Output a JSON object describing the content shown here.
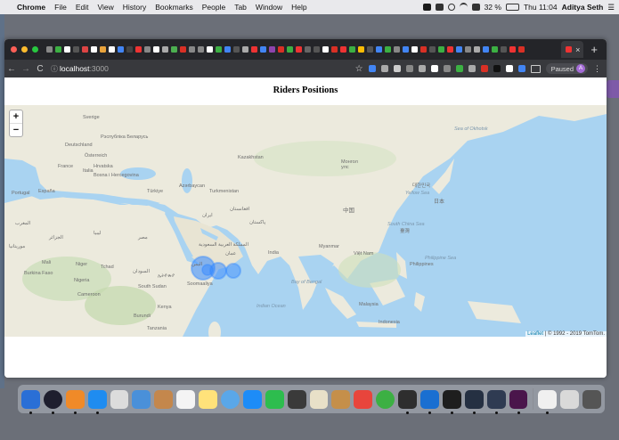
{
  "menubar": {
    "app": "Chrome",
    "items": [
      "File",
      "Edit",
      "View",
      "History",
      "Bookmarks",
      "People",
      "Tab",
      "Window",
      "Help"
    ],
    "battery": "32 %",
    "clock": "Thu 11:04",
    "user": "Aditya Seth"
  },
  "tabs": {
    "favicon_colors": [
      "#888",
      "#3cb043",
      "#fff",
      "#555",
      "#d44",
      "#fff",
      "#e8a33c",
      "#fff",
      "#4285f4",
      "#444",
      "#e33",
      "#888",
      "#fff",
      "#aaa",
      "#4caf50",
      "#d93025",
      "#888",
      "#888",
      "#fff",
      "#3cb043",
      "#4285f4",
      "#555",
      "#aaa",
      "#e33",
      "#4285f4",
      "#8e44ad",
      "#d93025",
      "#3cb043",
      "#e33",
      "#666",
      "#555",
      "#fff",
      "#d93025",
      "#e33",
      "#3cb043",
      "#fbbc05",
      "#555",
      "#4285f4",
      "#3cb043",
      "#888",
      "#4285f4",
      "#fff",
      "#d93025",
      "#555",
      "#3cb043",
      "#e33",
      "#4285f4",
      "#888",
      "#aaa",
      "#4285f4",
      "#3cb043",
      "#555",
      "#e33",
      "#d93025"
    ],
    "active_close": "×",
    "new_tab": "+"
  },
  "toolbar": {
    "back": "←",
    "forward": "→",
    "reload": "C",
    "url_host": "localhost",
    "url_port": ":3000",
    "star": "☆",
    "paused_label": "Paused",
    "avatar_letter": "A",
    "menu": "⋮",
    "extension_colors": [
      "#4285f4",
      "#aaa",
      "#ccc",
      "#888",
      "#aaa",
      "#fff",
      "#888",
      "#3cb043",
      "#aaa",
      "#d93025",
      "#111",
      "#fff",
      "#4285f4"
    ]
  },
  "page": {
    "title": "Riders Positions"
  },
  "map": {
    "zoom_in": "+",
    "zoom_out": "−",
    "attribution_link": "Leaflet",
    "attribution_text": " | © 1992 - 2019 TomTom.",
    "rider_marker_color": "#3388ff",
    "labels": {
      "kazakhstan": "Kazakhstan",
      "mongolia": "Монгол\nулс",
      "turkiye": "Türkiye",
      "turkmenistan": "Turkmenistan",
      "iran": "ایران",
      "afghanistan": "افغانستان",
      "pakistan": "پاکستان",
      "india": "India",
      "myanmar": "Myanmar",
      "china": "中国",
      "japan": "日本",
      "malaysia": "Malaysia",
      "indonesia": "Indonesia",
      "ethiopia": "ኢትዮጵያ",
      "kenya": "Kenya",
      "tanzania": "Tanzania",
      "burundi": "Burundi",
      "niger": "Niger",
      "mali": "Mali",
      "nigeria": "Nigeria",
      "cameroon": "Cameroon",
      "sudan": "السودان",
      "south_sudan": "South Sudan",
      "chad": "Tchad",
      "egypt": "مصر",
      "libya": "ليبيا",
      "algeria": "الجزائر",
      "morocco": "المغرب",
      "france": "France",
      "espana": "España",
      "deutschland": "Deutschland",
      "sverige": "Sverige",
      "belarus": "Рэспубліка Беларусь",
      "azerbaijan": "Azərbaycan",
      "saudi": "المملكة العربية السعودية",
      "oman": "عمان",
      "yemen": "اليمن",
      "somalia": "Soomaaliya",
      "burkina": "Burkina Faso",
      "mauritania": "موريتانيا",
      "philippines": "Philippines",
      "south_china_sea": "South China Sea",
      "philippine_sea": "Philippine Sea",
      "bay_of_bengal": "Bay of Bengal",
      "indian_ocean": "Indian Ocean",
      "sea_of_okhotsk": "Sea of Okhotsk",
      "yellow_sea": "Yellow Sea",
      "korea": "대한민국",
      "vietnam": "Việt Nam",
      "italia": "Italia",
      "osterreich": "Österreich",
      "hrvatska": "Hrvatska",
      "bih": "Bosna i Hercegovina",
      "portugal": "Portugal",
      "taiwan": "臺灣"
    }
  },
  "dock": {
    "colors": [
      "#2a6fd6",
      "#1e1e2e",
      "#f08a28",
      "#1f8cf0",
      "#dcdcdc",
      "#4a90d9",
      "#c4874c",
      "#f4f4f4",
      "#ffe27a",
      "#5aa7e8",
      "#1d8cf7",
      "#2dbd4e",
      "#3a3a3a",
      "#e8e0c8",
      "#c58f4a",
      "#e8453c",
      "#3cb043",
      "#2e2e2e",
      "#1a6fd1",
      "#1e1e1e",
      "#253042",
      "#2f3b52",
      "#4a154b",
      "#f0f0f0",
      "#d9d9d9",
      "#555"
    ],
    "running_indices": [
      0,
      1,
      2,
      3,
      17,
      18,
      19,
      20,
      21,
      22,
      23
    ]
  }
}
